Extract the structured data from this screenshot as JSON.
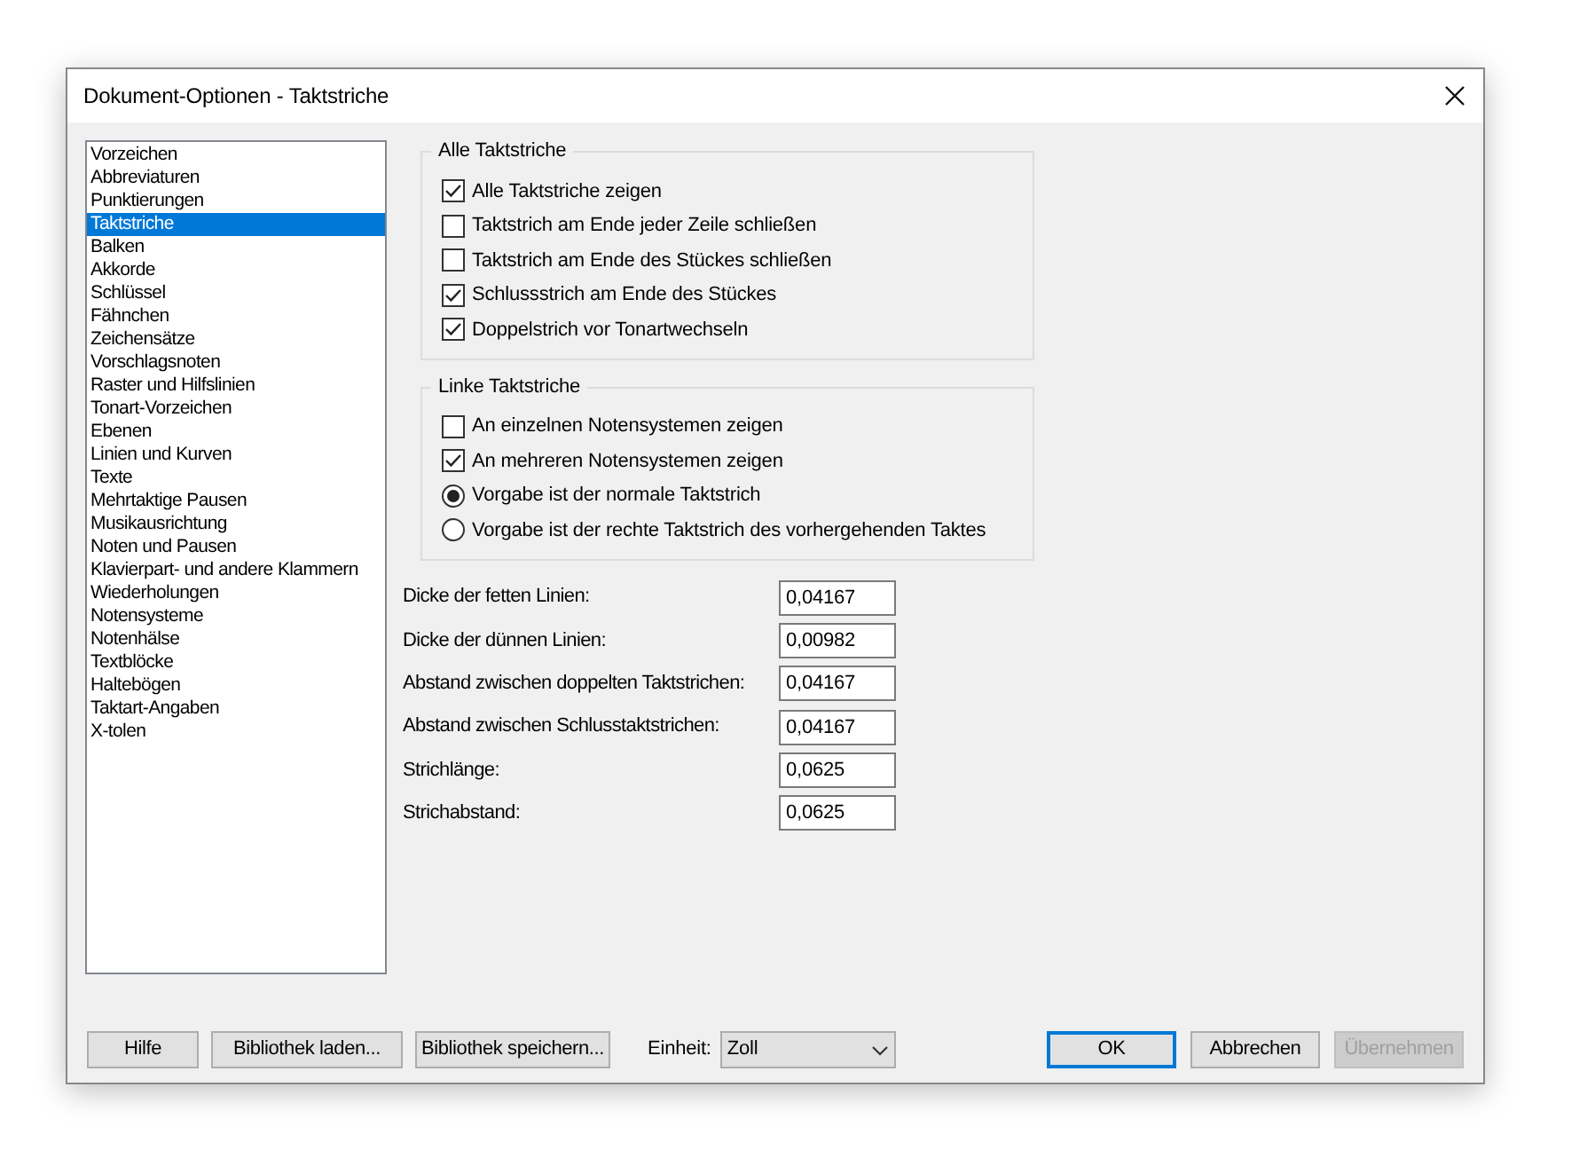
{
  "window": {
    "title": "Dokument-Optionen - Taktstriche"
  },
  "sidebar": {
    "items": [
      {
        "label": "Vorzeichen",
        "selected": false
      },
      {
        "label": "Abbreviaturen",
        "selected": false
      },
      {
        "label": "Punktierungen",
        "selected": false
      },
      {
        "label": "Taktstriche",
        "selected": true
      },
      {
        "label": "Balken",
        "selected": false
      },
      {
        "label": "Akkorde",
        "selected": false
      },
      {
        "label": "Schlüssel",
        "selected": false
      },
      {
        "label": "Fähnchen",
        "selected": false
      },
      {
        "label": "Zeichensätze",
        "selected": false
      },
      {
        "label": "Vorschlagsnoten",
        "selected": false
      },
      {
        "label": "Raster und Hilfslinien",
        "selected": false
      },
      {
        "label": "Tonart-Vorzeichen",
        "selected": false
      },
      {
        "label": "Ebenen",
        "selected": false
      },
      {
        "label": "Linien und Kurven",
        "selected": false
      },
      {
        "label": "Texte",
        "selected": false
      },
      {
        "label": "Mehrtaktige Pausen",
        "selected": false
      },
      {
        "label": "Musikausrichtung",
        "selected": false
      },
      {
        "label": "Noten und Pausen",
        "selected": false
      },
      {
        "label": "Klavierpart- und andere Klammern",
        "selected": false
      },
      {
        "label": "Wiederholungen",
        "selected": false
      },
      {
        "label": "Notensysteme",
        "selected": false
      },
      {
        "label": "Notenhälse",
        "selected": false
      },
      {
        "label": "Textblöcke",
        "selected": false
      },
      {
        "label": "Haltebögen",
        "selected": false
      },
      {
        "label": "Taktart-Angaben",
        "selected": false
      },
      {
        "label": "X-tolen",
        "selected": false
      }
    ]
  },
  "groups": [
    {
      "title": "Alle Taktstriche",
      "options": [
        {
          "kind": "checkbox",
          "label": "Alle Taktstriche zeigen",
          "checked": true
        },
        {
          "kind": "checkbox",
          "label": "Taktstrich am Ende jeder Zeile schließen",
          "checked": false
        },
        {
          "kind": "checkbox",
          "label": "Taktstrich am Ende des Stückes schließen",
          "checked": false
        },
        {
          "kind": "checkbox",
          "label": "Schlussstrich am Ende des Stückes",
          "checked": true
        },
        {
          "kind": "checkbox",
          "label": "Doppelstrich vor Tonartwechseln",
          "checked": true
        }
      ]
    },
    {
      "title": "Linke Taktstriche",
      "options": [
        {
          "kind": "checkbox",
          "label": "An einzelnen Notensystemen zeigen",
          "checked": false
        },
        {
          "kind": "checkbox",
          "label": "An mehreren Notensystemen zeigen",
          "checked": true
        },
        {
          "kind": "radio",
          "label": "Vorgabe ist der normale Taktstrich",
          "checked": true
        },
        {
          "kind": "radio",
          "label": "Vorgabe ist der rechte Taktstrich des vorhergehenden Taktes",
          "checked": false
        }
      ]
    }
  ],
  "fields": [
    {
      "label": "Dicke der fetten Linien:",
      "value": "0,04167"
    },
    {
      "label": "Dicke der dünnen Linien:",
      "value": "0,00982"
    },
    {
      "label": "Abstand zwischen doppelten Taktstrichen:",
      "value": "0,04167"
    },
    {
      "label": "Abstand zwischen Schlusstaktstrichen:",
      "value": "0,04167"
    },
    {
      "label": "Strichlänge:",
      "value": "0,0625"
    },
    {
      "label": "Strichabstand:",
      "value": "0,0625"
    }
  ],
  "left_buttons": [
    "Hilfe",
    "Bibliothek laden...",
    "Bibliothek speichern..."
  ],
  "unit": {
    "label": "Einheit:",
    "value": "Zoll"
  },
  "right_buttons": [
    {
      "label": "OK",
      "default": true,
      "disabled": false
    },
    {
      "label": "Abbrechen",
      "default": false,
      "disabled": false
    },
    {
      "label": "Übernehmen",
      "default": false,
      "disabled": true
    }
  ]
}
